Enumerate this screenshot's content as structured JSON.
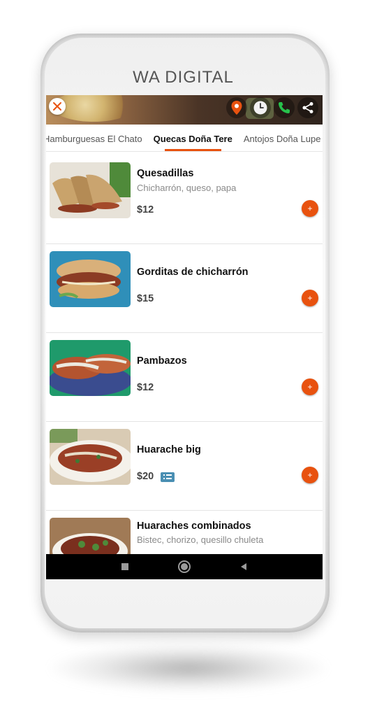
{
  "brand": "WA DIGITAL",
  "colors": {
    "accent": "#e8520f",
    "badge": "#4a8fb3"
  },
  "header": {
    "icons": [
      "close-icon",
      "map-pin-icon",
      "clock-icon",
      "phone-icon",
      "share-icon"
    ]
  },
  "tabs": [
    {
      "label": "Hamburguesas El Chato",
      "active": false
    },
    {
      "label": "Quecas Doña Tere",
      "active": true
    },
    {
      "label": "Antojos Doña Lupe",
      "active": false
    }
  ],
  "items": [
    {
      "name": "Quesadillas",
      "description": "Chicharrón, queso, papa",
      "price": "$12",
      "add_label": "+"
    },
    {
      "name": "Gorditas de chicharrón",
      "description": "",
      "price": "$15",
      "add_label": "+"
    },
    {
      "name": "Pambazos",
      "description": "",
      "price": "$12",
      "add_label": "+"
    },
    {
      "name": "Huarache big",
      "description": "",
      "price": "$20",
      "add_label": "+",
      "badge": "list-icon"
    },
    {
      "name": "Huaraches combinados",
      "description": "Bistec, chorizo, quesillo chuleta",
      "price": "",
      "add_label": "+"
    }
  ],
  "nav": [
    "recents-square-icon",
    "home-circle-icon",
    "back-triangle-icon"
  ]
}
